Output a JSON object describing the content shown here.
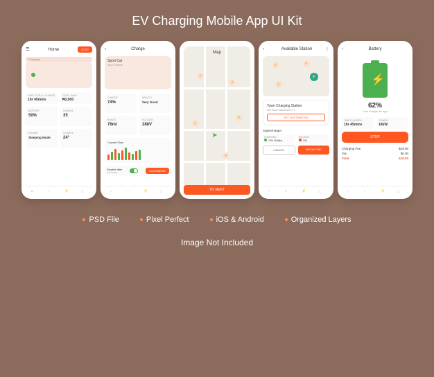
{
  "title": "EV Charging Mobile App UI Kit",
  "features": [
    "PSD File",
    "Pixel Perfect",
    "iOS & Android",
    "Organized Layers"
  ],
  "footer_note": "Image Not Included",
  "screen1": {
    "title": "Home",
    "stop": "STOP",
    "charging_badge": "Charging",
    "time_label": "TIME TO FULL CHARGE",
    "time_value": "1hr 45mins",
    "save_label": "TOTAL SAVE",
    "save_value": "₦3,000",
    "battery_label": "BATTERY",
    "battery_value": "50%",
    "charge_label": "CHARGE",
    "charge_value": "35",
    "engine_label": "ENGINE",
    "engine_value": "Sleeping Mode",
    "climate_label": "CLIMATE",
    "climate_value": "24°"
  },
  "screen2": {
    "title": "Charge",
    "vehicle_name": "Sport Car",
    "vehicle_sub": "Your Vehicle",
    "charge_label": "CHARGE",
    "charge_value": "74%",
    "health_label": "HEALTH",
    "health_value": "Very Good",
    "range_label": "RANGE",
    "range_value": "76mi",
    "voltage_label": "VOLTAGE",
    "voltage_value": "288V",
    "flow_title": "Current Flow",
    "disable_label": "Disable after",
    "disable_sub": "Full Charge",
    "discharge": "DISCHARGE"
  },
  "screen3": {
    "title": "Map",
    "to_next": "TO NEXT"
  },
  "screen4": {
    "title": "Available Station",
    "station_name": "Town Charging Station",
    "station_addr": "826 Claire Watsonville, FL",
    "set_dest": "SET DESTINATION",
    "sc_title": "Supercharger",
    "charged_label": "CHARGED",
    "charged_value": "74%",
    "time_label": "18 Mins",
    "booked_label": "BOOKED",
    "booked_value": "232",
    "cancel": "CANCEL",
    "begin": "BEGIN TRIP"
  },
  "screen5": {
    "title": "Battery",
    "pct": "62%",
    "pct_sub": "Last Charge 3w ago",
    "elapsed_label": "TIME ELAPSED",
    "elapsed_value": "1hr 45mins",
    "power_label": "POWER",
    "power_value": "18kW",
    "stop": "STOP",
    "fee_label": "Charging Fee",
    "fee_value": "$18.00",
    "tax_label": "Tax",
    "tax_value": "$0.00",
    "total_label": "Total",
    "total_value": "$18.00"
  }
}
